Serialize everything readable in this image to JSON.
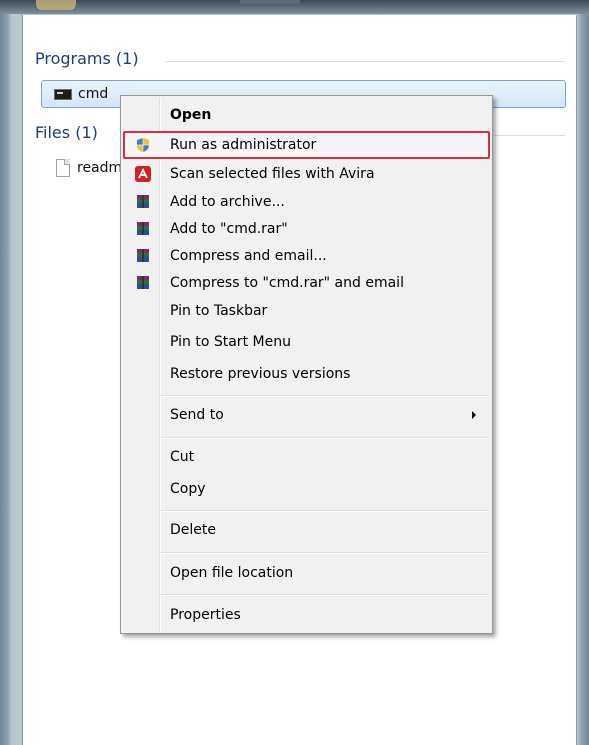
{
  "sections": {
    "programs_header": "Programs (1)",
    "files_header": "Files (1)"
  },
  "programs": [
    {
      "label": "cmd",
      "icon": "cmd-icon"
    }
  ],
  "files": [
    {
      "label": "readm",
      "icon": "file-icon"
    }
  ],
  "context_menu": {
    "items": [
      {
        "label": "Open",
        "bold": true
      },
      {
        "label": "Run as administrator",
        "icon": "uac-shield-icon",
        "highlighted": true
      },
      {
        "label": "Scan selected files with Avira",
        "icon": "avira-icon"
      },
      {
        "label": "Add to archive...",
        "icon": "winrar-icon"
      },
      {
        "label": "Add to \"cmd.rar\"",
        "icon": "winrar-icon"
      },
      {
        "label": "Compress and email...",
        "icon": "winrar-icon"
      },
      {
        "label": "Compress to \"cmd.rar\" and email",
        "icon": "winrar-icon"
      },
      {
        "label": "Pin to Taskbar"
      },
      {
        "label": "Pin to Start Menu"
      },
      {
        "label": "Restore previous versions"
      },
      {
        "label": "Send to",
        "submenu": true
      },
      {
        "label": "Cut"
      },
      {
        "label": "Copy"
      },
      {
        "label": "Delete"
      },
      {
        "label": "Open file location"
      },
      {
        "label": "Properties"
      }
    ]
  },
  "colors": {
    "highlight_border": "#d3313f",
    "selection_fill": "#d4e6f9",
    "section_header": "#1e3d74"
  }
}
